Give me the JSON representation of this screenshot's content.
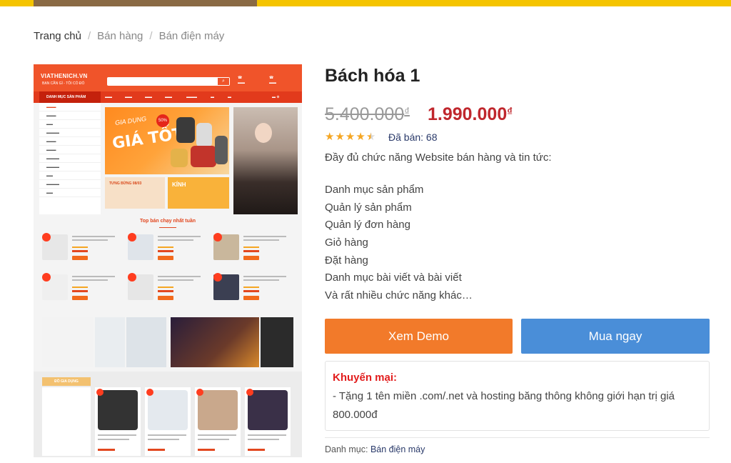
{
  "breadcrumb": {
    "home": "Trang chủ",
    "items": [
      "Bán hàng",
      "Bán điện máy"
    ],
    "separator": "/"
  },
  "preview": {
    "logo": "VIATHENICH.VN",
    "slogan": "BẠN CẦN GÌ - TÔI CÓ ĐÓ",
    "banner_line1": "GIA DỤNG",
    "banner_line2": "GIÁ TỐT",
    "banner_badge": "50%",
    "small_banner1": "TƯNG BỪNG 08/03",
    "small_banner2": "KÍNH",
    "best_seller": "Top bán chạy nhất tuần",
    "category_label": "DANH MỤC SẢN PHẨM",
    "bottom_label": "ĐỒ GIA DỤNG"
  },
  "product": {
    "title": "Bách hóa 1",
    "old_price": "5.400.000",
    "new_price": "1.990.000",
    "currency": "₫",
    "rating": 4.5,
    "sold_label": "Đã bán: 68",
    "description": "Đầy đủ chức năng Website bán hàng và tin tức:",
    "features": [
      "Danh mục sản phẩm",
      "Quản lý sản phẩm",
      "Quản lý đơn hàng",
      "Giỏ hàng",
      "Đặt hàng",
      "Danh mục bài viết và bài viết",
      "Và rất nhiều chức năng khác…"
    ]
  },
  "buttons": {
    "demo": "Xem Demo",
    "buy": "Mua ngay"
  },
  "promo": {
    "title": "Khuyến mại:",
    "text": "- Tặng 1 tên miền .com/.net và hosting băng thông không giới hạn trị giá 800.000đ"
  },
  "category": {
    "label": "Danh mục:",
    "value": "Bán điện máy"
  },
  "colors": {
    "accent_yellow": "#f5c400",
    "price_red": "#c0272d",
    "demo_orange": "#f27a2a",
    "buy_blue": "#4a8ed8",
    "star": "#f5a623"
  }
}
